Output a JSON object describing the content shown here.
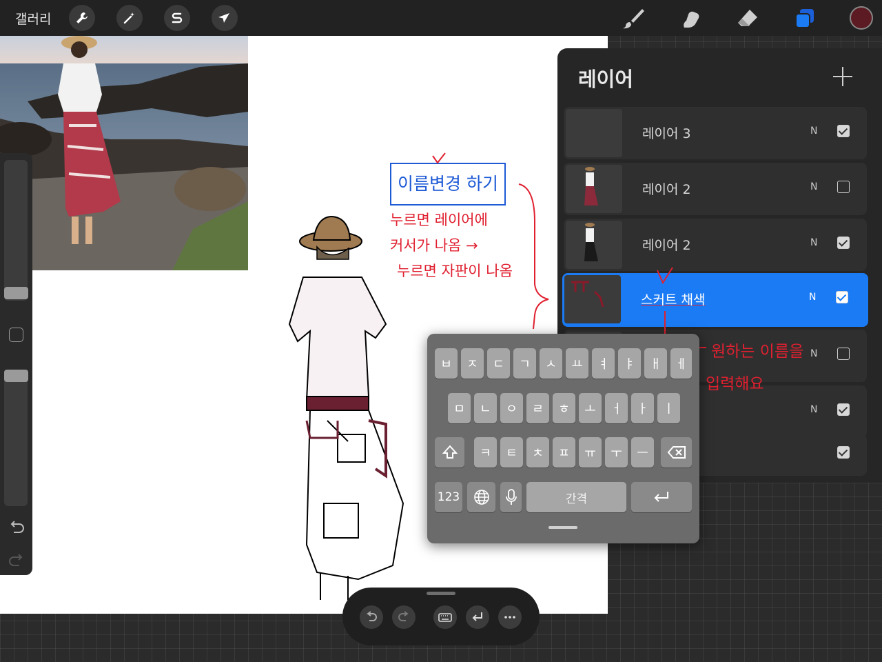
{
  "topbar": {
    "gallery_label": "갤러리",
    "tools": [
      "wrench-icon",
      "magic-wand-icon",
      "selection-s-icon",
      "transform-arrow-icon"
    ],
    "right_tools": [
      "brush-icon",
      "smudge-icon",
      "eraser-icon",
      "layers-icon"
    ],
    "current_color": "#5c1a22"
  },
  "layers": {
    "title": "레이어",
    "rows": [
      {
        "name": "레이어 3",
        "blend": "N",
        "visible": true
      },
      {
        "name": "레이어 2",
        "blend": "N",
        "visible": false
      },
      {
        "name": "레이어 2",
        "blend": "N",
        "visible": true
      },
      {
        "name": "스커트 채색",
        "blend": "N",
        "visible": true,
        "active": true
      },
      {
        "name": "",
        "blend": "N",
        "visible": false
      },
      {
        "name": "",
        "blend": "N",
        "visible": true
      },
      {
        "name": "",
        "blend": "",
        "visible": true
      }
    ]
  },
  "keyboard": {
    "row1": [
      "ㅂ",
      "ㅈ",
      "ㄷ",
      "ㄱ",
      "ㅅ",
      "ㅛ",
      "ㅕ",
      "ㅑ",
      "ㅐ",
      "ㅔ"
    ],
    "row2": [
      "ㅁ",
      "ㄴ",
      "ㅇ",
      "ㄹ",
      "ㅎ",
      "ㅗ",
      "ㅓ",
      "ㅏ",
      "ㅣ"
    ],
    "row3": [
      "ㅋ",
      "ㅌ",
      "ㅊ",
      "ㅍ",
      "ㅠ",
      "ㅜ",
      "ㅡ"
    ],
    "numbers_label": "123",
    "space_label": "간격"
  },
  "annotations": {
    "title": "이름변경 하기",
    "line1": "누르면 레이어에",
    "line2": "커서가 나옴 →",
    "line3": "누르면 자판이 나옴",
    "note1": "원하는 이름을",
    "note2": "입력해요"
  },
  "colors": {
    "accent_blue": "#1b7bf5",
    "annotation_red": "#e02030",
    "annotation_blue": "#1d5ad6"
  }
}
